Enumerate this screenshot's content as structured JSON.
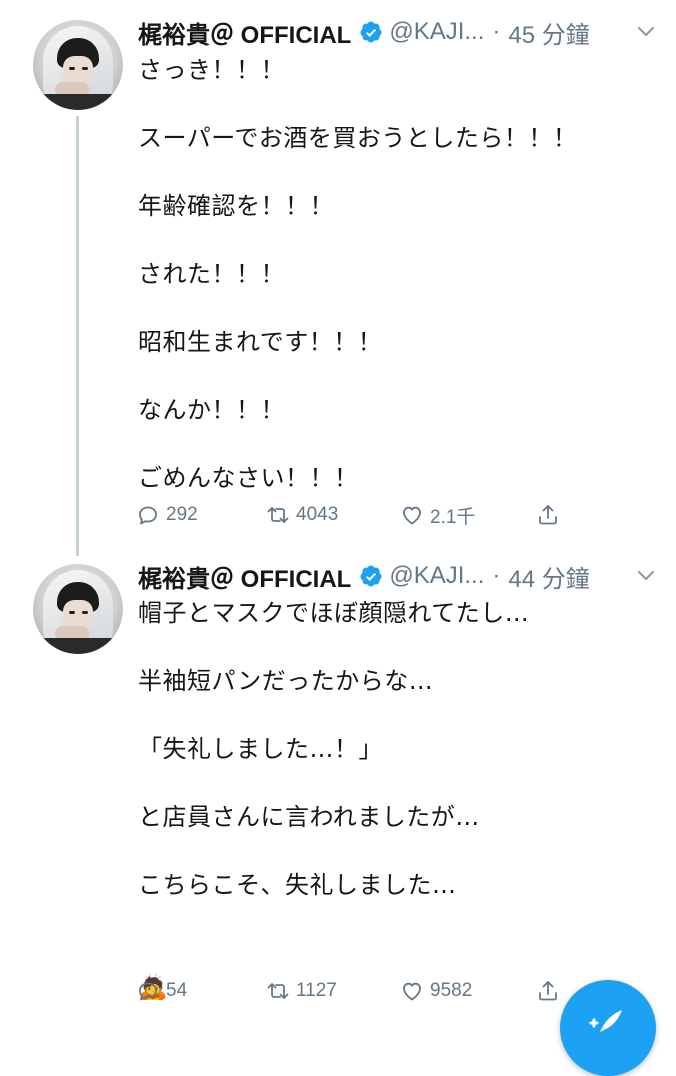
{
  "colors": {
    "text_primary": "#14171a",
    "text_secondary": "#657786",
    "accent": "#1da1f2",
    "thread_line": "#c4cfd6"
  },
  "tweets": [
    {
      "author_name": "梶裕貴＠ OFFICIAL",
      "handle": "@KAJI...",
      "separator": "·",
      "time": "45 分鐘",
      "verified_icon": "verified-badge-icon",
      "lines": [
        "さっき！！！",
        "",
        "スーパーでお酒を買おうとしたら！！！",
        "",
        "年齢確認を！！！",
        "",
        "された！！！",
        "",
        "昭和生まれです！！！",
        "",
        "なんか！！！",
        "",
        "ごめんなさい！！！"
      ],
      "actions": {
        "reply_count": "292",
        "retweet_count": "4043",
        "like_count": "2.1千"
      }
    },
    {
      "author_name": "梶裕貴＠ OFFICIAL",
      "handle": "@KAJI...",
      "separator": "·",
      "time": "44 分鐘",
      "verified_icon": "verified-badge-icon",
      "lines": [
        "帽子とマスクでほぼ顔隠れてたし…",
        "",
        "半袖短パンだったからな…",
        "",
        "「失礼しました…！」",
        "",
        "と店員さんに言われましたが…",
        "",
        "こちらこそ、失礼しました…",
        "",
        ""
      ],
      "emoji": "🙇",
      "actions": {
        "reply_count": "54",
        "retweet_count": "1127",
        "like_count": "9582"
      }
    }
  ],
  "fab": {
    "icon": "compose-tweet-icon"
  }
}
